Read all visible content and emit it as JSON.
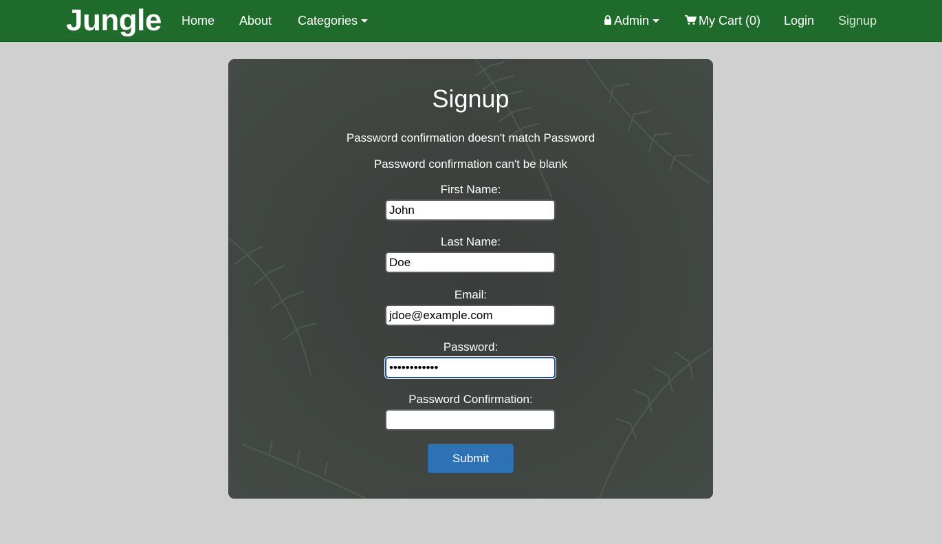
{
  "nav": {
    "brand": "Jungle",
    "home": "Home",
    "about": "About",
    "categories": "Categories",
    "admin": "Admin",
    "cart": "My Cart (0)",
    "login": "Login",
    "signup": "Signup"
  },
  "colors": {
    "navbar": "#1e6b2c",
    "page_background": "#d0d0d0",
    "panel": "#3c3f3d",
    "submit_button": "#2e72b6"
  },
  "icons": {
    "admin": "lock-icon",
    "cart": "cart-icon"
  },
  "form": {
    "title": "Signup",
    "errors": [
      "Password confirmation doesn't match Password",
      "Password confirmation can't be blank"
    ],
    "first_name": {
      "label": "First Name:",
      "value": "John"
    },
    "last_name": {
      "label": "Last Name:",
      "value": "Doe"
    },
    "email": {
      "label": "Email:",
      "value": "jdoe@example.com"
    },
    "password": {
      "label": "Password:",
      "value": "••••••••••••"
    },
    "password_confirmation": {
      "label": "Password Confirmation:",
      "value": ""
    },
    "submit": "Submit"
  }
}
